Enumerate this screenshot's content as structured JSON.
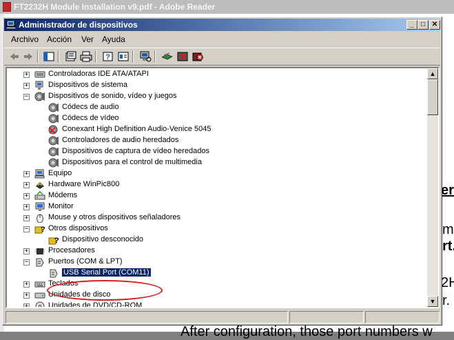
{
  "background": {
    "title": "FT2232H Module Installation v9.pdf - Adobe Reader",
    "doc_fragments": [
      "er",
      "m",
      "rt.",
      "2H",
      "r.",
      "After configuration, those port numbers w"
    ]
  },
  "window": {
    "title": "Administrador de dispositivos",
    "minimize_glyph": "_",
    "maximize_glyph": "□",
    "close_glyph": "✕"
  },
  "menu": [
    "Archivo",
    "Acción",
    "Ver",
    "Ayuda"
  ],
  "tree": [
    {
      "label": "Controladoras IDE ATA/ATAPI",
      "level": 0,
      "expander": "+",
      "icon": "ide-controller-icon"
    },
    {
      "label": "Dispositivos de sistema",
      "level": 0,
      "expander": "+",
      "icon": "system-device-icon"
    },
    {
      "label": "Dispositivos de sonido, vídeo y juegos",
      "level": 0,
      "expander": "−",
      "icon": "sound-icon"
    },
    {
      "label": "Códecs de audio",
      "level": 1,
      "expander": "",
      "icon": "sound-icon"
    },
    {
      "label": "Códecs de vídeo",
      "level": 1,
      "expander": "",
      "icon": "sound-icon"
    },
    {
      "label": "Conexant High Definition Audio-Venice 5045",
      "level": 1,
      "expander": "",
      "icon": "sound-disabled-icon"
    },
    {
      "label": "Controladores de audio heredados",
      "level": 1,
      "expander": "",
      "icon": "sound-icon"
    },
    {
      "label": "Dispositivos de captura de vídeo heredados",
      "level": 1,
      "expander": "",
      "icon": "sound-icon"
    },
    {
      "label": "Dispositivos para el control de multimedia",
      "level": 1,
      "expander": "",
      "icon": "sound-icon"
    },
    {
      "label": "Equipo",
      "level": 0,
      "expander": "+",
      "icon": "computer-icon"
    },
    {
      "label": "Hardware WinPic800",
      "level": 0,
      "expander": "+",
      "icon": "chip-icon"
    },
    {
      "label": "Módems",
      "level": 0,
      "expander": "+",
      "icon": "modem-icon"
    },
    {
      "label": "Monitor",
      "level": 0,
      "expander": "+",
      "icon": "monitor-icon"
    },
    {
      "label": "Mouse y otros dispositivos señaladores",
      "level": 0,
      "expander": "+",
      "icon": "mouse-icon"
    },
    {
      "label": "Otros dispositivos",
      "level": 0,
      "expander": "−",
      "icon": "unknown-device-icon"
    },
    {
      "label": "Dispositivo desconocido",
      "level": 1,
      "expander": "",
      "icon": "unknown-device-icon"
    },
    {
      "label": "Procesadores",
      "level": 0,
      "expander": "+",
      "icon": "processor-icon"
    },
    {
      "label": "Puertos (COM & LPT)",
      "level": 0,
      "expander": "−",
      "icon": "port-icon"
    },
    {
      "label": "USB Serial Port (COM11)",
      "level": 1,
      "expander": "",
      "icon": "port-icon",
      "selected": true
    },
    {
      "label": "Teclados",
      "level": 0,
      "expander": "+",
      "icon": "keyboard-icon"
    },
    {
      "label": "Unidades de disco",
      "level": 0,
      "expander": "+",
      "icon": "disk-icon"
    },
    {
      "label": "Unidades de DVD/CD-ROM",
      "level": 0,
      "expander": "+",
      "icon": "cdrom-icon"
    }
  ],
  "scroll": {
    "up_glyph": "▲",
    "down_glyph": "▼"
  },
  "colors": {
    "selection": "#0a246a",
    "annotation": "#d21e1e",
    "title_gradient_start": "#0a246a"
  }
}
